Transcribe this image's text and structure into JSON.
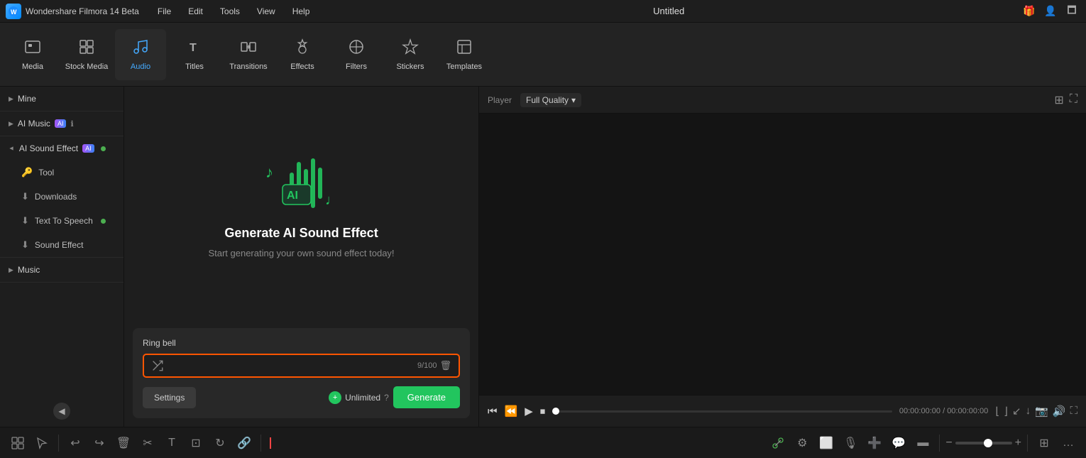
{
  "app": {
    "name": "Wondershare Filmora 14 Beta",
    "window_title": "Untitled"
  },
  "menu": {
    "items": [
      "File",
      "Edit",
      "Tools",
      "View",
      "Help"
    ]
  },
  "toolbar": {
    "items": [
      {
        "id": "media",
        "label": "Media",
        "icon": "⬜",
        "active": false
      },
      {
        "id": "stock-media",
        "label": "Stock Media",
        "icon": "🖼",
        "active": false
      },
      {
        "id": "audio",
        "label": "Audio",
        "icon": "♫",
        "active": true
      },
      {
        "id": "titles",
        "label": "Titles",
        "icon": "T",
        "active": false
      },
      {
        "id": "transitions",
        "label": "Transitions",
        "icon": "⟷",
        "active": false
      },
      {
        "id": "effects",
        "label": "Effects",
        "icon": "✦",
        "active": false
      },
      {
        "id": "filters",
        "label": "Filters",
        "icon": "◈",
        "active": false
      },
      {
        "id": "stickers",
        "label": "Stickers",
        "icon": "★",
        "active": false
      },
      {
        "id": "templates",
        "label": "Templates",
        "icon": "▣",
        "active": false
      }
    ]
  },
  "sidebar": {
    "sections": [
      {
        "id": "mine",
        "label": "Mine",
        "expanded": false,
        "has_arrow": true
      },
      {
        "id": "ai-music",
        "label": "AI Music",
        "expanded": false,
        "has_arrow": true,
        "has_ai_badge": true,
        "has_info": true
      },
      {
        "id": "ai-sound-effect",
        "label": "AI Sound Effect",
        "expanded": true,
        "has_arrow": true,
        "has_ai_badge": true,
        "has_dot": true
      },
      {
        "id": "tool",
        "label": "Tool",
        "icon": "🔑",
        "sub": true
      },
      {
        "id": "downloads",
        "label": "Downloads",
        "icon": "⬇",
        "sub": true
      },
      {
        "id": "text-to-speech",
        "label": "Text To Speech",
        "icon": "⬇",
        "sub": true,
        "has_dot": true
      },
      {
        "id": "sound-effect",
        "label": "Sound Effect",
        "icon": "⬇",
        "sub": true
      },
      {
        "id": "music",
        "label": "Music",
        "expanded": false,
        "has_arrow": true
      }
    ]
  },
  "ai_sound": {
    "title": "Generate AI Sound Effect",
    "subtitle": "Start generating your own sound effect today!",
    "input_label": "Ring bell",
    "input_text": "Ring bell",
    "char_count": "9/100",
    "settings_label": "Settings",
    "unlimited_label": "Unlimited",
    "generate_label": "Generate"
  },
  "player": {
    "label": "Player",
    "quality": "Full Quality",
    "time_current": "00:00:00:00",
    "time_total": "00:00:00:00"
  },
  "bottom_toolbar": {
    "zoom_minus": "-",
    "zoom_plus": "+"
  }
}
